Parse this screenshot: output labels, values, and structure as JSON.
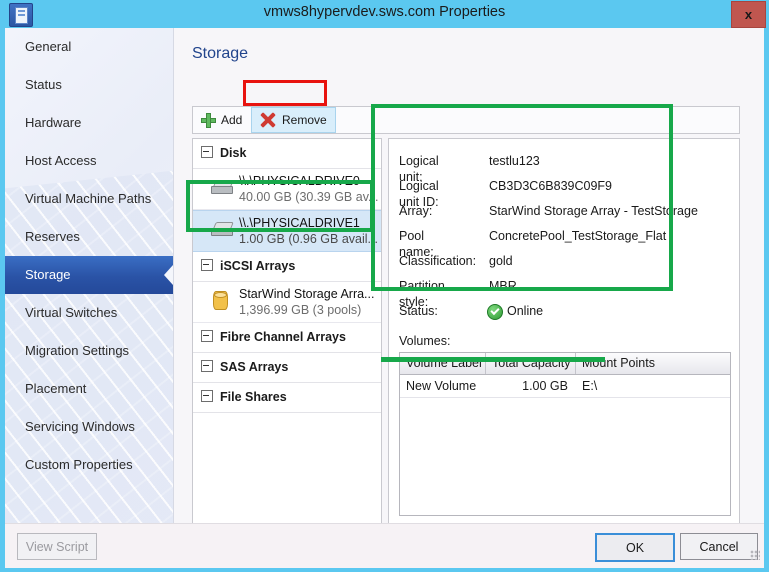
{
  "window": {
    "title": "vmws8hypervdev.sws.com Properties",
    "app_icon": "server-properties-icon",
    "close_label": "x"
  },
  "sidebar": {
    "items": [
      {
        "label": "General",
        "selected": false
      },
      {
        "label": "Status",
        "selected": false
      },
      {
        "label": "Hardware",
        "selected": false
      },
      {
        "label": "Host Access",
        "selected": false
      },
      {
        "label": "Virtual Machine Paths",
        "selected": false
      },
      {
        "label": "Reserves",
        "selected": false
      },
      {
        "label": "Storage",
        "selected": true
      },
      {
        "label": "Virtual Switches",
        "selected": false
      },
      {
        "label": "Migration Settings",
        "selected": false
      },
      {
        "label": "Placement",
        "selected": false
      },
      {
        "label": "Servicing Windows",
        "selected": false
      },
      {
        "label": "Custom Properties",
        "selected": false
      }
    ]
  },
  "main": {
    "heading": "Storage",
    "toolbar": {
      "add_label": "Add",
      "remove_label": "Remove"
    },
    "tree": {
      "groups": [
        {
          "label": "Disk"
        },
        {
          "label": "iSCSI Arrays"
        },
        {
          "label": "Fibre Channel Arrays"
        },
        {
          "label": "SAS Arrays"
        },
        {
          "label": "File Shares"
        }
      ],
      "disk_nodes": [
        {
          "name": "\\\\.\\PHYSICALDRIVE0",
          "detail": "40.00 GB (30.39 GB av...",
          "selected": false
        },
        {
          "name": "\\\\.\\PHYSICALDRIVE1",
          "detail": "1.00 GB (0.96 GB avail...",
          "selected": true
        }
      ],
      "iscsi_nodes": [
        {
          "name": "StarWind Storage Arra...",
          "detail": "1,396.99 GB (3 pools)",
          "selected": false
        }
      ]
    },
    "details": {
      "rows": [
        {
          "key": "Logical unit:",
          "value": "testlu123"
        },
        {
          "key": "Logical unit ID:",
          "value": "CB3D3C6B839C09F9"
        },
        {
          "key": "Array:",
          "value": "StarWind Storage Array - TestStorage"
        },
        {
          "key": "Pool name:",
          "value": "ConcretePool_TestStorage_Flat"
        },
        {
          "key": "Classification:",
          "value": "gold"
        },
        {
          "key": "Partition style:",
          "value": "MBR"
        }
      ],
      "status_key": "Status:",
      "status_value": "Online",
      "status_icon": "check-circle-icon",
      "volumes_label": "Volumes:",
      "volumes_headers": [
        "Volume Label",
        "Total Capacity",
        "Mount Points"
      ],
      "volumes_rows": [
        {
          "label": "New Volume",
          "capacity": "1.00 GB",
          "mount": "E:\\"
        }
      ]
    }
  },
  "footer": {
    "view_script_label": "View Script",
    "ok_label": "OK",
    "cancel_label": "Cancel"
  },
  "colors": {
    "titlebar": "#5bc8f0",
    "selected_nav": "#2a53a6",
    "heading": "#21448c",
    "annotation_red": "#e8130f",
    "annotation_green": "#17a84a",
    "status_green": "#2f9a34"
  }
}
